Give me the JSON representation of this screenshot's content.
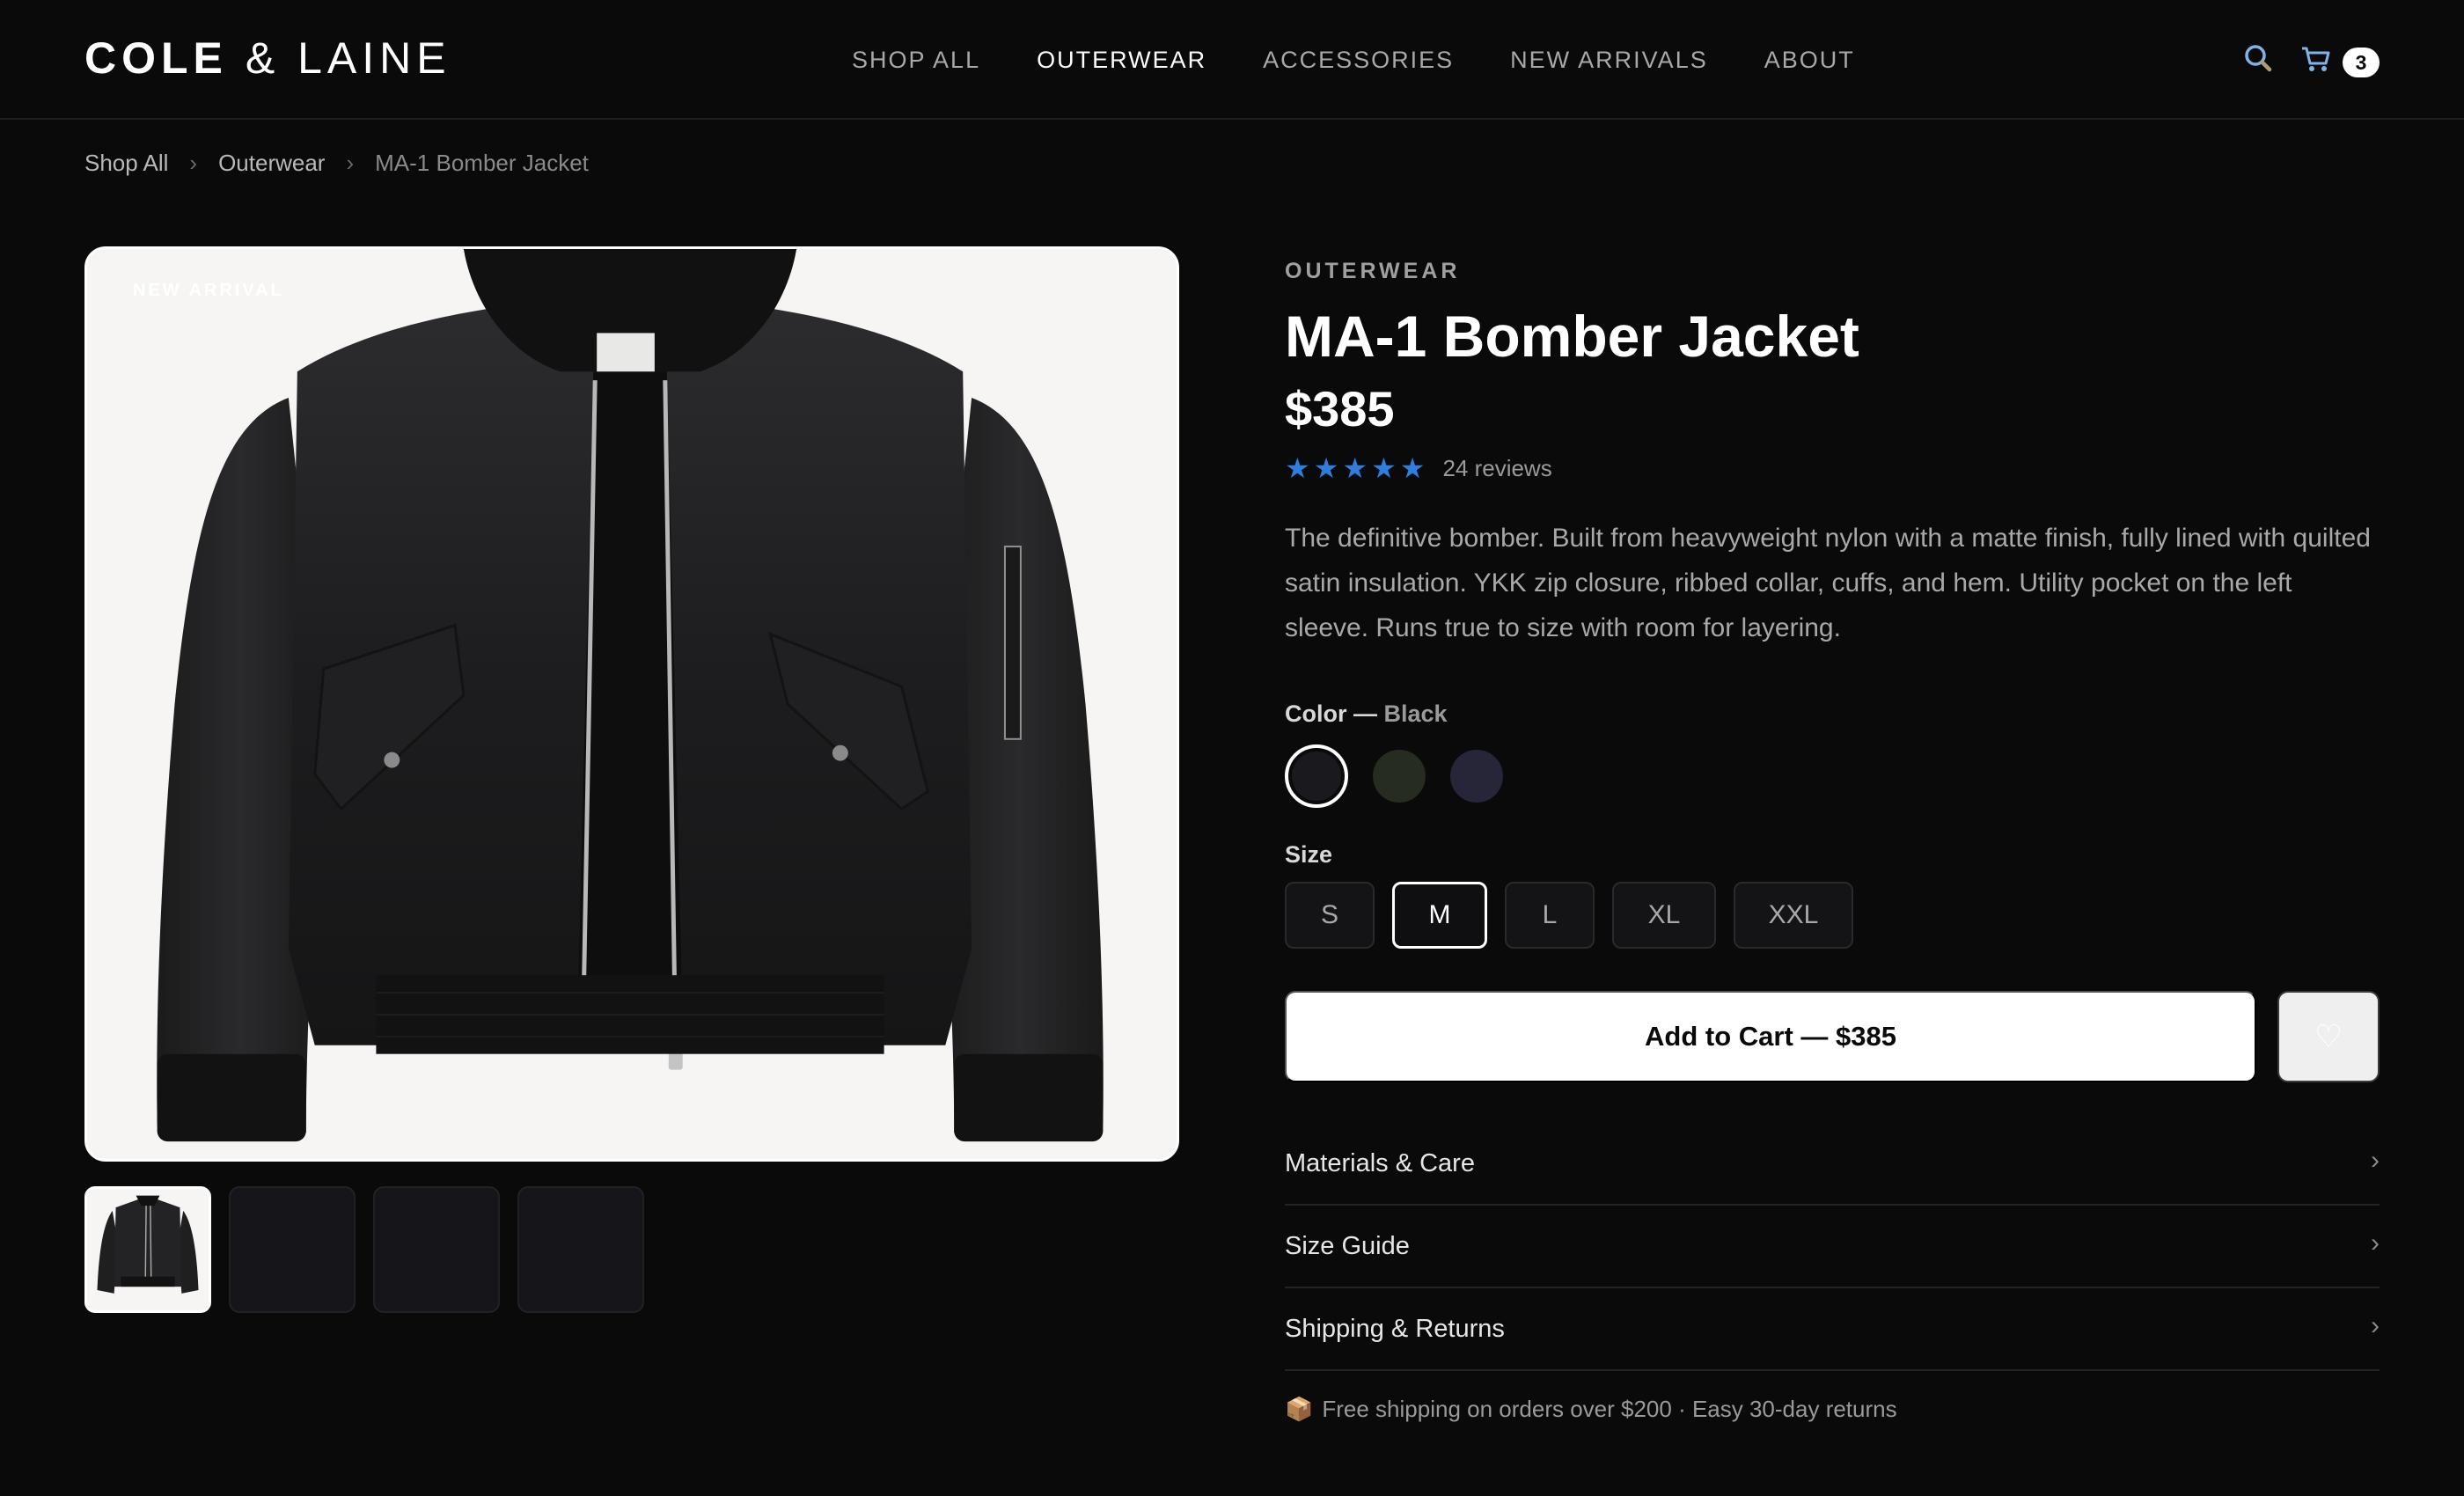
{
  "brand": {
    "part1": "COLE",
    "amp": "&",
    "part2": "LAINE"
  },
  "nav": {
    "items": [
      {
        "label": "SHOP ALL"
      },
      {
        "label": "OUTERWEAR"
      },
      {
        "label": "ACCESSORIES"
      },
      {
        "label": "NEW ARRIVALS"
      },
      {
        "label": "ABOUT"
      }
    ],
    "active": "OUTERWEAR"
  },
  "header": {
    "search_icon": "search-icon",
    "cart_icon": "cart-icon",
    "cart_count": "3"
  },
  "breadcrumb": {
    "items": [
      "Shop All",
      "Outerwear",
      "MA-1 Bomber Jacket"
    ],
    "separator": "›"
  },
  "gallery": {
    "badge": "NEW ARRIVAL",
    "thumbnail_count": 4,
    "active_thumbnail": 1
  },
  "product": {
    "category": "OUTERWEAR",
    "title": "MA-1 Bomber Jacket",
    "price": "$385",
    "rating": 5,
    "star_glyph": "★",
    "reviews": "24 reviews",
    "description": "The definitive bomber. Built from heavyweight nylon with a matte finish, fully lined with quilted satin insulation. YKK zip closure, ribbed collar, cuffs, and hem. Utility pocket on the left sleeve. Runs true to size with room for layering."
  },
  "color": {
    "label": "Color —",
    "selected": "Black",
    "options": [
      {
        "name": "Black",
        "hex": "#1a1a1e"
      },
      {
        "name": "Olive",
        "hex": "#262c1f"
      },
      {
        "name": "Navy",
        "hex": "#272639"
      }
    ]
  },
  "size": {
    "label": "Size",
    "options": [
      "S",
      "M",
      "L",
      "XL",
      "XXL"
    ],
    "selected": "M"
  },
  "actions": {
    "add_to_cart": "Add to Cart — $385",
    "wishlist_icon": "heart-icon",
    "wishlist_glyph": "♡"
  },
  "accordion": {
    "items": [
      "Materials & Care",
      "Size Guide",
      "Shipping & Returns"
    ],
    "chevron": "›"
  },
  "shipping_note": {
    "icon": "📦",
    "text": "Free shipping on orders over $200 · Easy 30-day returns"
  },
  "colors": {
    "background": "#0a0a0a",
    "star": "#2f7dde",
    "image_bg": "#f6f5f3"
  }
}
